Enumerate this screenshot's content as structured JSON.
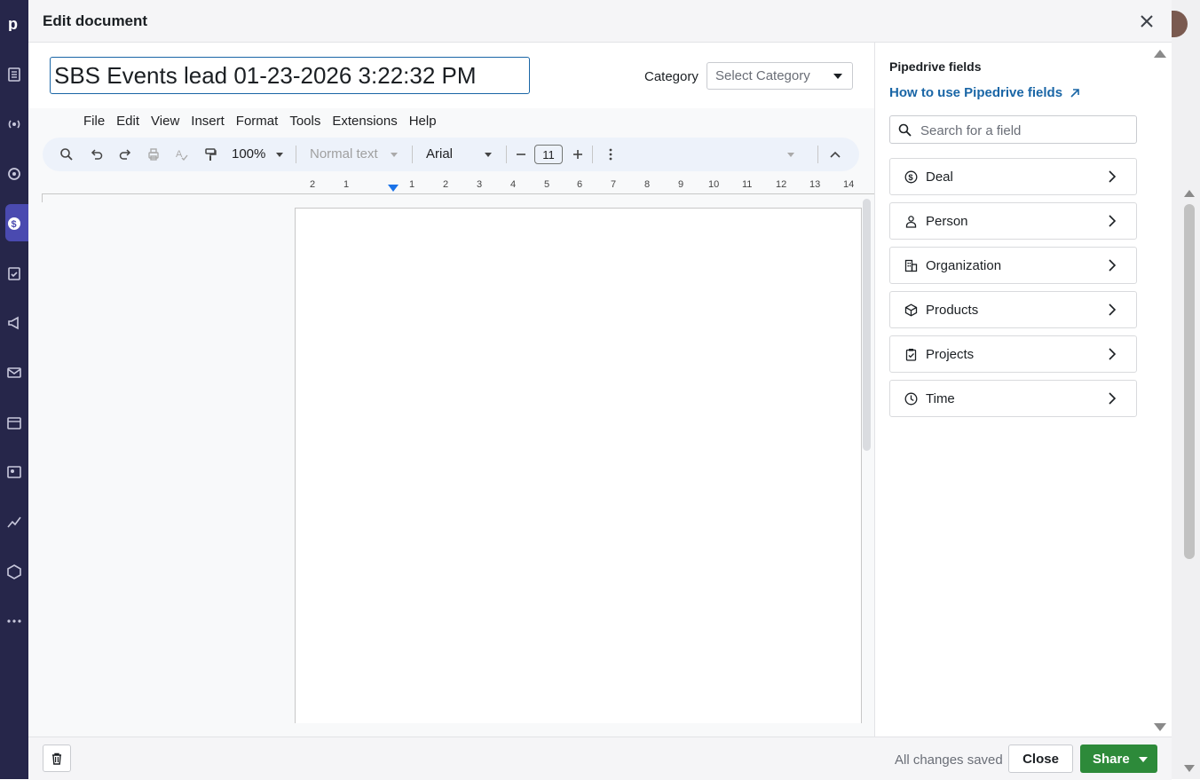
{
  "modal": {
    "title": "Edit document",
    "document_title": "SBS Events lead 01-23-2026 3:22:32 PM",
    "category_label": "Category",
    "category_placeholder": "Select Category"
  },
  "docs": {
    "menu": [
      "File",
      "Edit",
      "View",
      "Insert",
      "Format",
      "Tools",
      "Extensions",
      "Help"
    ],
    "toolbar": {
      "zoom": "100%",
      "style": "Normal text",
      "font": "Arial",
      "font_size": "11"
    },
    "ruler": [
      "2",
      "1",
      "1",
      "2",
      "3",
      "4",
      "5",
      "6",
      "7",
      "8",
      "9",
      "10",
      "11",
      "12",
      "13",
      "14"
    ]
  },
  "fields_panel": {
    "title": "Pipedrive fields",
    "help_link": "How to use Pipedrive fields",
    "search_placeholder": "Search for a field",
    "items": [
      {
        "label": "Deal",
        "icon": "dollar-circle-icon"
      },
      {
        "label": "Person",
        "icon": "person-icon"
      },
      {
        "label": "Organization",
        "icon": "building-icon"
      },
      {
        "label": "Products",
        "icon": "box-icon"
      },
      {
        "label": "Projects",
        "icon": "clipboard-icon"
      },
      {
        "label": "Time",
        "icon": "clock-icon"
      }
    ]
  },
  "footer": {
    "status": "All changes saved",
    "close_label": "Close",
    "share_label": "Share"
  }
}
